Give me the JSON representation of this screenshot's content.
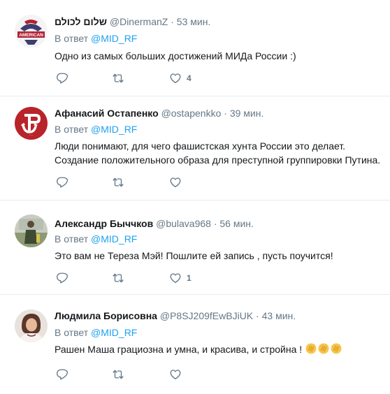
{
  "tweets": [
    {
      "name": "שלום לכולם",
      "handle": "@DinermanZ",
      "time": "53 мин.",
      "reply_prefix": "В ответ",
      "reply_to": "@MID_RF",
      "text": "Одно из самых больших достижений МИДа России :)",
      "avatar_text": "AMERICAN",
      "likes": "4",
      "retweets": "",
      "replies": ""
    },
    {
      "name": "Афанасий Остапенко",
      "handle": "@ostapenkko",
      "time": "39 мин.",
      "reply_prefix": "В ответ",
      "reply_to": "@MID_RF",
      "text": "Люди понимают, для чего фашистская хунта России это делает. Создание положительного образа для преступной группировки Путина.",
      "likes": "",
      "retweets": "",
      "replies": ""
    },
    {
      "name": "Александр Быччков",
      "handle": "@bulava968",
      "time": "56 мин.",
      "reply_prefix": "В ответ",
      "reply_to": "@MID_RF",
      "text": "Это вам не Тереза Мэй! Пошлите ей запись , пусть поучится!",
      "likes": "1",
      "retweets": "",
      "replies": ""
    },
    {
      "name": "Людмила Борисовна",
      "handle": "@P8SJ209fEwBJiUK",
      "time": "43 мин.",
      "reply_prefix": "В ответ",
      "reply_to": "@MID_RF",
      "text": "Рашен Маша грациозна и умна, и красива, и стройна !",
      "likes": "",
      "retweets": "",
      "replies": ""
    }
  ],
  "separator": "·",
  "icons": {
    "reply": "reply-icon",
    "retweet": "retweet-icon",
    "like": "heart-icon",
    "emoji": "clapping-hands-emoji"
  },
  "colors": {
    "link": "#1da1f2",
    "muted": "#657786",
    "text": "#14171a",
    "divider": "#e6ecf0"
  }
}
